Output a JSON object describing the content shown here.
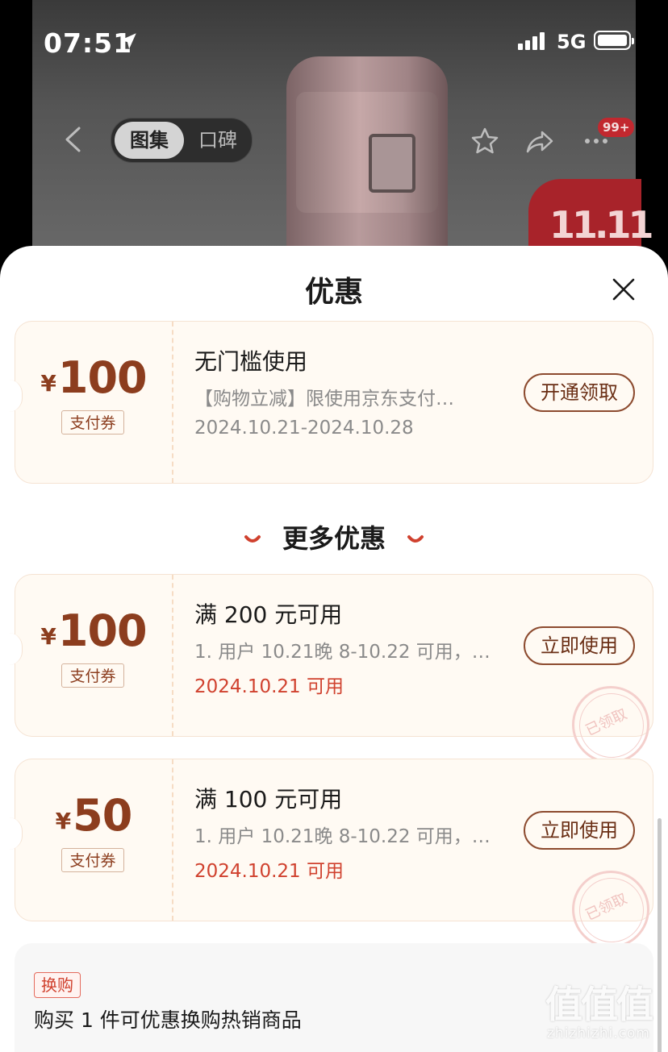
{
  "status_bar": {
    "time": "07:51",
    "network": "5G"
  },
  "nav": {
    "tabs": [
      "图集",
      "口碑"
    ],
    "message_badge": "99+",
    "sale_badge": "11.11"
  },
  "sheet": {
    "title": "优惠",
    "top_coupon": {
      "currency": "¥",
      "amount": "100",
      "type": "支付券",
      "title": "无门槛使用",
      "desc": "【购物立减】限使用京东支付…",
      "date": "2024.10.21-2024.10.28",
      "button": "开通领取"
    },
    "more_heading": "更多优惠",
    "more_coupons": [
      {
        "currency": "¥",
        "amount": "100",
        "type": "支付券",
        "title": "满 200 元可用",
        "desc": "1. 用户 10.21晚 8-10.22 可用，…",
        "date": "2024.10.21 可用",
        "button": "立即使用",
        "stamp": "已领取"
      },
      {
        "currency": "¥",
        "amount": "50",
        "type": "支付券",
        "title": "满 100 元可用",
        "desc": "1. 用户 10.21晚 8-10.22 可用，…",
        "date": "2024.10.21 可用",
        "button": "立即使用",
        "stamp": "已领取"
      }
    ],
    "exchange": {
      "tag": "换购",
      "text": "购买 1 件可优惠换购热销商品"
    }
  },
  "watermark": {
    "big": "值值值",
    "small": "zhizhizhi.com"
  },
  "colors": {
    "accent_brown": "#8c3d1e",
    "date_red": "#d0412e",
    "coupon_bg": "#fffaf3"
  }
}
